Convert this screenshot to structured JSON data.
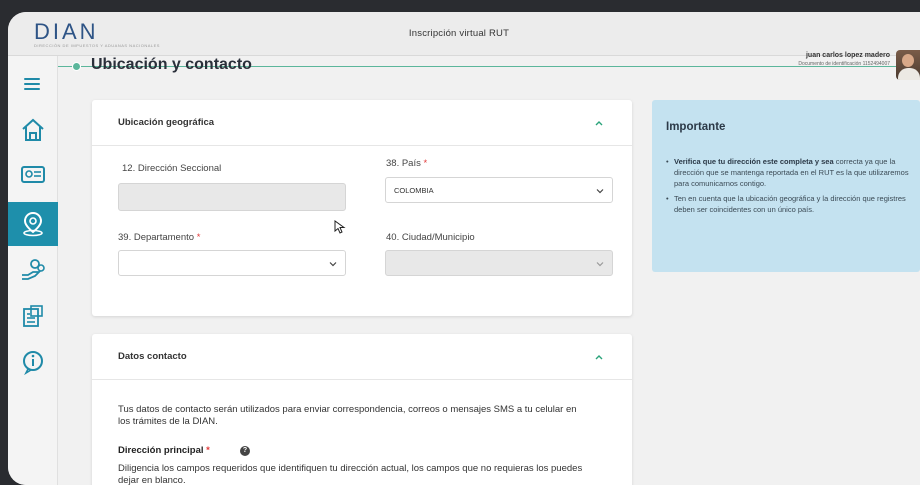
{
  "header": {
    "logo_text": "DIAN",
    "logo_sub": "DIRECCIÓN DE IMPUESTOS Y ADUANAS NACIONALES",
    "title": "Inscripción virtual RUT"
  },
  "page": {
    "title": "Ubicación y contacto"
  },
  "user": {
    "name": "juan carlos lopez madero",
    "document": "Documento de identificación 1152494007"
  },
  "sidebar": {
    "items": [
      {
        "name": "home-icon",
        "active": false
      },
      {
        "name": "id-card-icon",
        "active": false
      },
      {
        "name": "location-pin-icon",
        "active": true
      },
      {
        "name": "hand-coins-icon",
        "active": false
      },
      {
        "name": "building-money-icon",
        "active": false
      },
      {
        "name": "info-icon",
        "active": false
      }
    ]
  },
  "geo": {
    "title": "Ubicación geográfica",
    "seccional_label": "12. Dirección Seccional",
    "pais_label": "38. País",
    "pais_value": "COLOMBIA",
    "departamento_label": "39. Departamento",
    "ciudad_label": "40. Ciudad/Municipio",
    "required_mark": "*"
  },
  "contact": {
    "title": "Datos contacto",
    "intro": "Tus datos de contacto serán utilizados para enviar correspondencia, correos o mensajes SMS a tu celular en los trámites de la DIAN.",
    "address_title": "Dirección principal",
    "help": "?",
    "address_desc": "Diligencia los campos requeridos que identifiquen tu dirección actual, los campos que no requieras los puedes dejar en blanco."
  },
  "info": {
    "title": "Importante",
    "bullet1_bold": "Verifica que tu dirección este completa y sea",
    "bullet1_rest": "correcta ya que la dirección que se mantenga reportada en el RUT es la que utilizaremos para comunicarnos contigo.",
    "bullet2": "Ten en cuenta que la ubicación geográfica y la dirección que registres deben ser coincidentes con un único país."
  },
  "colors": {
    "accent": "#1e8fab",
    "title_line": "#5bb69b",
    "info_bg": "#c4e2f0",
    "required": "#e23b3b"
  }
}
